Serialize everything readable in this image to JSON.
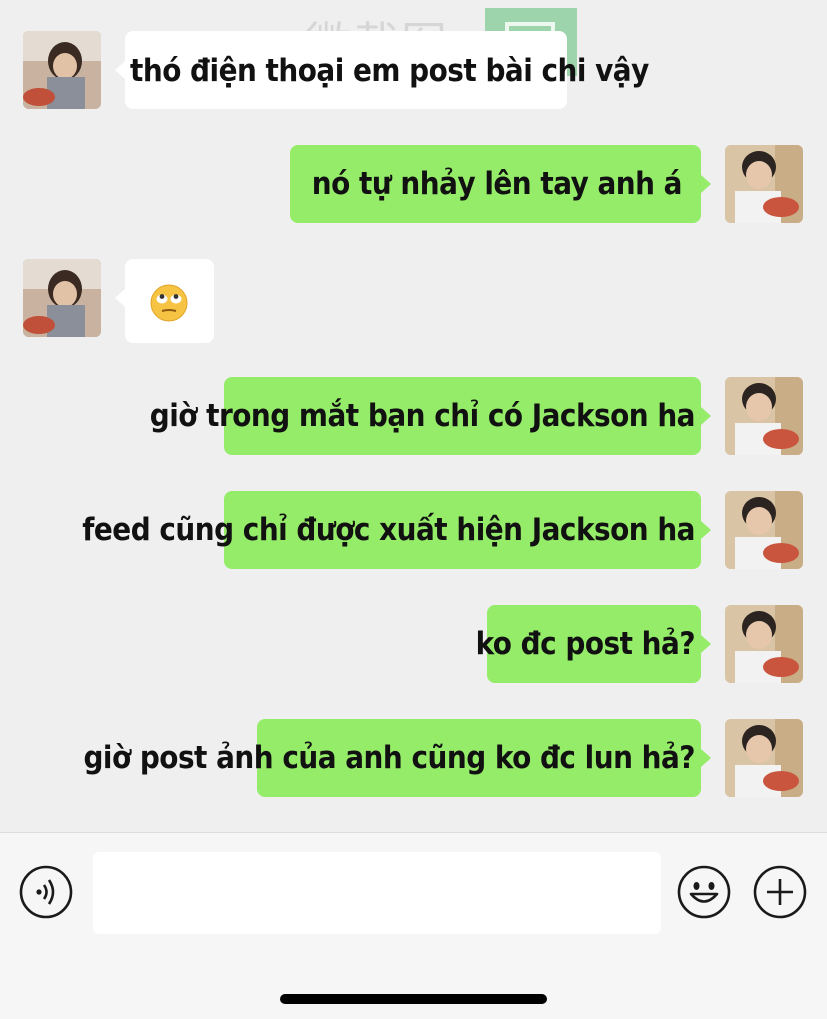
{
  "messages": [
    {
      "side": "left",
      "type": "text",
      "text": "thó điện thoại em post bài chi vậy"
    },
    {
      "side": "right",
      "type": "text",
      "text": "nó tự nhảy lên tay anh á"
    },
    {
      "side": "left",
      "type": "emoji",
      "emoji": "rolling-eyes-emoji"
    },
    {
      "side": "right",
      "type": "text",
      "text": "giờ trong mắt bạn chỉ có Jackson ha"
    },
    {
      "side": "right",
      "type": "text",
      "text": "feed cũng chỉ được xuất hiện Jackson ha"
    },
    {
      "side": "right",
      "type": "text",
      "text": "ko đc post hả?"
    },
    {
      "side": "right",
      "type": "text",
      "text": "giờ post ảnh của anh cũng ko đc lun hả?"
    }
  ],
  "watermark": {
    "text": "微截图"
  },
  "input_bar": {
    "voice_icon": "voice-icon",
    "message_value": "",
    "emoji_icon": "emoji-icon",
    "plus_icon": "plus-icon"
  },
  "colors": {
    "background": "#efefef",
    "bubble_green": "#95ec69",
    "bubble_white": "#ffffff"
  }
}
